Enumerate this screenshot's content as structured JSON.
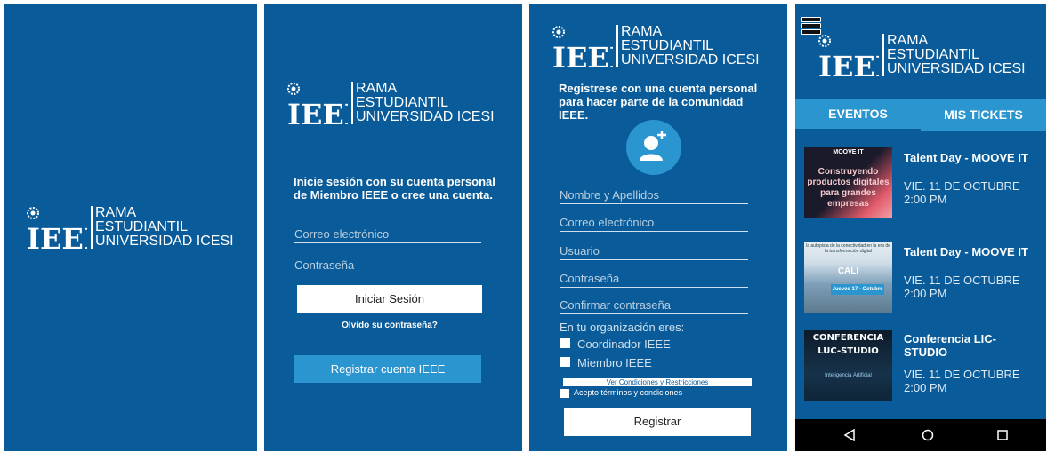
{
  "brand": {
    "line1": "RAMA",
    "line2": "ESTUDIANTIL",
    "line3": "UNIVERSIDAD ICESI",
    "logo_text": "IEEE"
  },
  "login": {
    "intro": "Inicie sesión con su cuenta personal de Miembro IEEE o cree una cuenta.",
    "email_placeholder": "Correo electrónico",
    "password_placeholder": "Contraseña",
    "login_button": "Iniciar Sesión",
    "forgot_link": "Olvido su contraseña?",
    "register_button": "Registrar cuenta IEEE"
  },
  "register": {
    "intro": "Registrese con una cuenta personal para hacer parte de la comunidad IEEE.",
    "fields": [
      "Nombre y Apellidos",
      "Correo electrónico",
      "Usuario",
      "Contraseña",
      "Confirmar contraseña"
    ],
    "org_label": "En tu organización eres:",
    "option_coordinator": "Coordinador IEEE",
    "option_member": "Miembro IEEE",
    "terms_link": "Ver Condiciones y Restricciones",
    "accept_terms": "Acepto términos y condiciones",
    "register_button": "Registrar"
  },
  "events_screen": {
    "tabs": [
      "EVENTOS",
      "MIS TICKETS"
    ],
    "events": [
      {
        "title": "Talent Day - MOOVE IT",
        "date": "VIE. 11 DE OCTUBRE",
        "time": "2:00 PM",
        "thumb_brand": "MOOVE IT",
        "thumb_text": "Construyendo productos digitales para grandes empresas"
      },
      {
        "title": "Talent Day - MOOVE IT",
        "date": "VIE. 11 DE OCTUBRE",
        "time": "2:00 PM",
        "thumb_text": "la autopista de la conectividad en la era de la transformación digital",
        "thumb_city": "CALI",
        "thumb_date": "Jueves 17 - Octubre"
      },
      {
        "title": "Conferencia LIC-STUDIO",
        "date": "VIE. 11 DE OCTUBRE",
        "time": "2:00 PM",
        "thumb_title1": "CONFERENCIA",
        "thumb_title2": "LUC-STUDIO",
        "thumb_text": "Inteligencia Artificial"
      }
    ],
    "nav": [
      "back",
      "home",
      "recents"
    ]
  },
  "colors": {
    "background": "#0a5b99",
    "tab_bar": "#2b95cf",
    "nav_bar": "#000000",
    "accent": "#2b95cf"
  }
}
